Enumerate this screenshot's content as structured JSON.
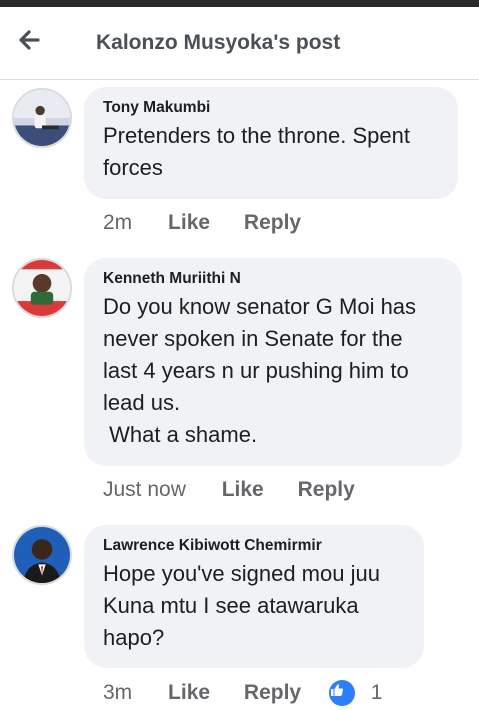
{
  "header": {
    "title": "Kalonzo Musyoka's post"
  },
  "comments": [
    {
      "author": "Tony Makumbi",
      "text": "Pretenders to the throne. Spent forces",
      "time": "2m",
      "like_label": "Like",
      "reply_label": "Reply"
    },
    {
      "author": "Kenneth Muriithi N",
      "text": "Do you know senator G Moi has never spoken in Senate for the last 4 years n ur pushing him to lead us.\n What a shame.",
      "time": "Just now",
      "like_label": "Like",
      "reply_label": "Reply"
    },
    {
      "author": "Lawrence Kibiwott Chemirmir",
      "text": "Hope you've signed mou juu Kuna mtu I see atawaruka hapo?",
      "time": "3m",
      "like_label": "Like",
      "reply_label": "Reply",
      "reaction_icon": "like-icon",
      "reaction_count": "1"
    }
  ],
  "colors": {
    "bubble": "#f0f2f5",
    "meta": "#65676b",
    "like_blue": "#2d7ff9"
  }
}
